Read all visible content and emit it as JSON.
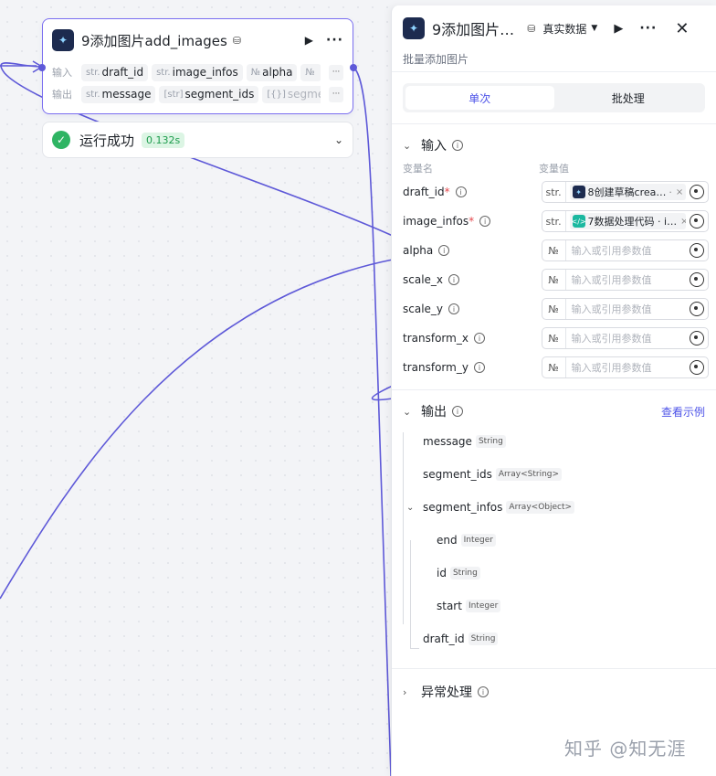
{
  "node": {
    "title": "9添加图片add_images",
    "inputs_label": "输入",
    "outputs_label": "输出",
    "inputs": [
      {
        "type": "str.",
        "name": "draft_id"
      },
      {
        "type": "str.",
        "name": "image_infos"
      },
      {
        "type": "№",
        "name": "alpha"
      },
      {
        "type": "№",
        "name": ""
      }
    ],
    "outputs": [
      {
        "type": "str.",
        "name": "message"
      },
      {
        "type": "[str]",
        "name": "segment_ids"
      },
      {
        "type": "[{}]",
        "name": "segment"
      }
    ],
    "more": "···"
  },
  "run_status": {
    "text": "运行成功",
    "time": "0.132s"
  },
  "panel": {
    "title": "9添加图片…",
    "mode": "真实数据",
    "description": "批量添加图片",
    "tabs": [
      "单次",
      "批处理"
    ],
    "input_section": "输入",
    "col_name": "变量名",
    "col_value": "变量值",
    "params": [
      {
        "name": "draft_id",
        "required": true,
        "type": "str.",
        "ref": "8创建草稿crea…",
        "ref_suffix": "·",
        "ref_icon": "coze"
      },
      {
        "name": "image_infos",
        "required": true,
        "type": "str.",
        "ref": "7数据处理代码 · i…",
        "ref_suffix": "",
        "ref_icon": "code"
      },
      {
        "name": "alpha",
        "required": false,
        "type": "№",
        "placeholder": "输入或引用参数值"
      },
      {
        "name": "scale_x",
        "required": false,
        "type": "№",
        "placeholder": "输入或引用参数值"
      },
      {
        "name": "scale_y",
        "required": false,
        "type": "№",
        "placeholder": "输入或引用参数值"
      },
      {
        "name": "transform_x",
        "required": false,
        "type": "№",
        "placeholder": "输入或引用参数值"
      },
      {
        "name": "transform_y",
        "required": false,
        "type": "№",
        "placeholder": "输入或引用参数值"
      }
    ],
    "output_section": "输出",
    "output_link": "查看示例",
    "outputs": [
      {
        "name": "message",
        "type": "String"
      },
      {
        "name": "segment_ids",
        "type": "Array<String>"
      },
      {
        "name": "segment_infos",
        "type": "Array<Object>"
      },
      {
        "name": "end",
        "type": "Integer"
      },
      {
        "name": "id",
        "type": "String"
      },
      {
        "name": "start",
        "type": "Integer"
      },
      {
        "name": "draft_id",
        "type": "String"
      }
    ],
    "error_section": "异常处理"
  },
  "watermark": "知乎 @知无涯"
}
